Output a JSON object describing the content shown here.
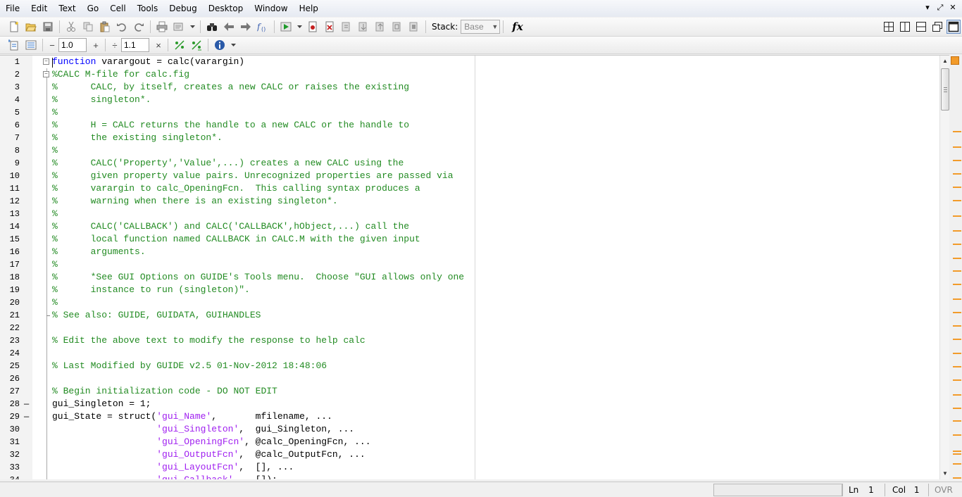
{
  "menu": [
    "File",
    "Edit",
    "Text",
    "Go",
    "Cell",
    "Tools",
    "Debug",
    "Desktop",
    "Window",
    "Help"
  ],
  "window_controls": [
    {
      "name": "restore-down-icon",
      "glyph": "▾"
    },
    {
      "name": "maximize-icon",
      "glyph": "⤢"
    },
    {
      "name": "close-icon",
      "glyph": "✕"
    }
  ],
  "toolbar": {
    "stack_label": "Stack:",
    "stack_value": "Base",
    "fx_label": "fx"
  },
  "cell_toolbar": {
    "decrement_label": "−",
    "increment_value": "1.0",
    "plus_label": "+",
    "divide_label": "÷",
    "multiply_value": "1.1",
    "times_label": "×"
  },
  "editor": {
    "lines": [
      {
        "n": "1",
        "bp": "",
        "fold": "box",
        "segments": [
          {
            "t": "function",
            "c": "kw"
          },
          {
            "t": " varargout = calc(varargin)",
            "c": ""
          }
        ]
      },
      {
        "n": "2",
        "bp": "",
        "fold": "box",
        "segments": [
          {
            "t": "%CALC M-file for calc.fig",
            "c": "cm"
          }
        ]
      },
      {
        "n": "3",
        "bp": "",
        "fold": "",
        "segments": [
          {
            "t": "%      CALC, by itself, creates a new CALC or raises the existing",
            "c": "cm"
          }
        ]
      },
      {
        "n": "4",
        "bp": "",
        "fold": "",
        "segments": [
          {
            "t": "%      singleton*.",
            "c": "cm"
          }
        ]
      },
      {
        "n": "5",
        "bp": "",
        "fold": "",
        "segments": [
          {
            "t": "%",
            "c": "cm"
          }
        ]
      },
      {
        "n": "6",
        "bp": "",
        "fold": "",
        "segments": [
          {
            "t": "%      H = CALC returns the handle to a new CALC or the handle to",
            "c": "cm"
          }
        ]
      },
      {
        "n": "7",
        "bp": "",
        "fold": "",
        "segments": [
          {
            "t": "%      the existing singleton*.",
            "c": "cm"
          }
        ]
      },
      {
        "n": "8",
        "bp": "",
        "fold": "",
        "segments": [
          {
            "t": "%",
            "c": "cm"
          }
        ]
      },
      {
        "n": "9",
        "bp": "",
        "fold": "",
        "segments": [
          {
            "t": "%      CALC('Property','Value',...) creates a new CALC using the",
            "c": "cm"
          }
        ]
      },
      {
        "n": "10",
        "bp": "",
        "fold": "",
        "segments": [
          {
            "t": "%      given property value pairs. Unrecognized properties are passed via",
            "c": "cm"
          }
        ]
      },
      {
        "n": "11",
        "bp": "",
        "fold": "",
        "segments": [
          {
            "t": "%      varargin to calc_OpeningFcn.  This calling syntax produces a",
            "c": "cm"
          }
        ]
      },
      {
        "n": "12",
        "bp": "",
        "fold": "",
        "segments": [
          {
            "t": "%      warning when there is an existing singleton*.",
            "c": "cm"
          }
        ]
      },
      {
        "n": "13",
        "bp": "",
        "fold": "",
        "segments": [
          {
            "t": "%",
            "c": "cm"
          }
        ]
      },
      {
        "n": "14",
        "bp": "",
        "fold": "",
        "segments": [
          {
            "t": "%      CALC('CALLBACK') and CALC('CALLBACK',hObject,...) call the",
            "c": "cm"
          }
        ]
      },
      {
        "n": "15",
        "bp": "",
        "fold": "",
        "segments": [
          {
            "t": "%      local function named CALLBACK in CALC.M with the given input",
            "c": "cm"
          }
        ]
      },
      {
        "n": "16",
        "bp": "",
        "fold": "",
        "segments": [
          {
            "t": "%      arguments.",
            "c": "cm"
          }
        ]
      },
      {
        "n": "17",
        "bp": "",
        "fold": "",
        "segments": [
          {
            "t": "%",
            "c": "cm"
          }
        ]
      },
      {
        "n": "18",
        "bp": "",
        "fold": "",
        "segments": [
          {
            "t": "%      *See GUI Options on GUIDE's Tools menu.  Choose \"GUI allows only one",
            "c": "cm"
          }
        ]
      },
      {
        "n": "19",
        "bp": "",
        "fold": "",
        "segments": [
          {
            "t": "%      instance to run (singleton)\".",
            "c": "cm"
          }
        ]
      },
      {
        "n": "20",
        "bp": "",
        "fold": "",
        "segments": [
          {
            "t": "%",
            "c": "cm"
          }
        ]
      },
      {
        "n": "21",
        "bp": "",
        "fold": "end",
        "segments": [
          {
            "t": "% See also: GUIDE, GUIDATA, GUIHANDLES",
            "c": "cm"
          }
        ]
      },
      {
        "n": "22",
        "bp": "",
        "fold": "",
        "segments": []
      },
      {
        "n": "23",
        "bp": "",
        "fold": "",
        "segments": [
          {
            "t": "% Edit the above text to modify the response to help calc",
            "c": "cm"
          }
        ]
      },
      {
        "n": "24",
        "bp": "",
        "fold": "",
        "segments": []
      },
      {
        "n": "25",
        "bp": "",
        "fold": "",
        "segments": [
          {
            "t": "% Last Modified by GUIDE v2.5 01-Nov-2012 18:48:06",
            "c": "cm"
          }
        ]
      },
      {
        "n": "26",
        "bp": "",
        "fold": "",
        "segments": []
      },
      {
        "n": "27",
        "bp": "",
        "fold": "",
        "segments": [
          {
            "t": "% Begin initialization code - DO NOT EDIT",
            "c": "cm"
          }
        ]
      },
      {
        "n": "28",
        "bp": "—",
        "fold": "",
        "segments": [
          {
            "t": "gui_Singleton = 1;",
            "c": ""
          }
        ]
      },
      {
        "n": "29",
        "bp": "—",
        "fold": "",
        "segments": [
          {
            "t": "gui_State = struct(",
            "c": ""
          },
          {
            "t": "'gui_Name'",
            "c": "st"
          },
          {
            "t": ",       mfilename, ...",
            "c": ""
          }
        ]
      },
      {
        "n": "30",
        "bp": "",
        "fold": "",
        "segments": [
          {
            "t": "                   ",
            "c": ""
          },
          {
            "t": "'gui_Singleton'",
            "c": "st"
          },
          {
            "t": ",  gui_Singleton, ...",
            "c": ""
          }
        ]
      },
      {
        "n": "31",
        "bp": "",
        "fold": "",
        "segments": [
          {
            "t": "                   ",
            "c": ""
          },
          {
            "t": "'gui_OpeningFcn'",
            "c": "st"
          },
          {
            "t": ", @calc_OpeningFcn, ...",
            "c": ""
          }
        ]
      },
      {
        "n": "32",
        "bp": "",
        "fold": "",
        "segments": [
          {
            "t": "                   ",
            "c": ""
          },
          {
            "t": "'gui_OutputFcn'",
            "c": "st"
          },
          {
            "t": ",  @calc_OutputFcn, ...",
            "c": ""
          }
        ]
      },
      {
        "n": "33",
        "bp": "",
        "fold": "",
        "segments": [
          {
            "t": "                   ",
            "c": ""
          },
          {
            "t": "'gui_LayoutFcn'",
            "c": "st"
          },
          {
            "t": ",  [], ...",
            "c": ""
          }
        ]
      },
      {
        "n": "34",
        "bp": "",
        "fold": "",
        "segments": [
          {
            "t": "                   ",
            "c": ""
          },
          {
            "t": "'gui_Callback'",
            "c": "st"
          },
          {
            "t": ",   []);",
            "c": ""
          }
        ]
      }
    ]
  },
  "status": {
    "ln_label": "Ln",
    "ln_value": "1",
    "col_label": "Col",
    "col_value": "1",
    "mode": "OVR"
  },
  "colors": {
    "keyword": "#0000ff",
    "comment": "#228b22",
    "string": "#a020f0",
    "analyzer_warning": "#f29b2a"
  }
}
